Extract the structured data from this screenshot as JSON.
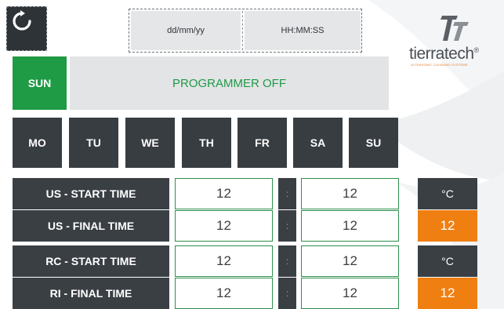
{
  "header": {
    "date_placeholder": "dd/mm/yy",
    "time_placeholder": "HH:MM:SS"
  },
  "logo": {
    "brand": "tierratech",
    "registered": "®",
    "tagline": "ULTRASONIC CLEANING SYSTEMS"
  },
  "status": {
    "current_day": "SUN",
    "programmer": "PROGRAMMER OFF"
  },
  "weekdays": [
    "MO",
    "TU",
    "WE",
    "TH",
    "FR",
    "SA",
    "SU"
  ],
  "rows": [
    {
      "label": "US - START TIME",
      "left": "12",
      "separator": ":",
      "right": "12"
    },
    {
      "label": "US - FINAL TIME",
      "left": "12",
      "separator": ":",
      "right": "12"
    },
    {
      "label": "RC - START TIME",
      "left": "12",
      "separator": ":",
      "right": "12"
    },
    {
      "label": "RI - FINAL TIME",
      "left": "12",
      "separator": ":",
      "right": "12"
    }
  ],
  "temperature": [
    {
      "unit": "°C",
      "value": "12"
    },
    {
      "unit": "°C",
      "value": "12"
    }
  ],
  "colors": {
    "dark": "#3a3f44",
    "green": "#1f9a45",
    "orange": "#f07f12",
    "light_gray": "#e2e4e6"
  },
  "icons": {
    "refresh": "refresh-icon",
    "logo": "tierratech-logo-icon"
  }
}
